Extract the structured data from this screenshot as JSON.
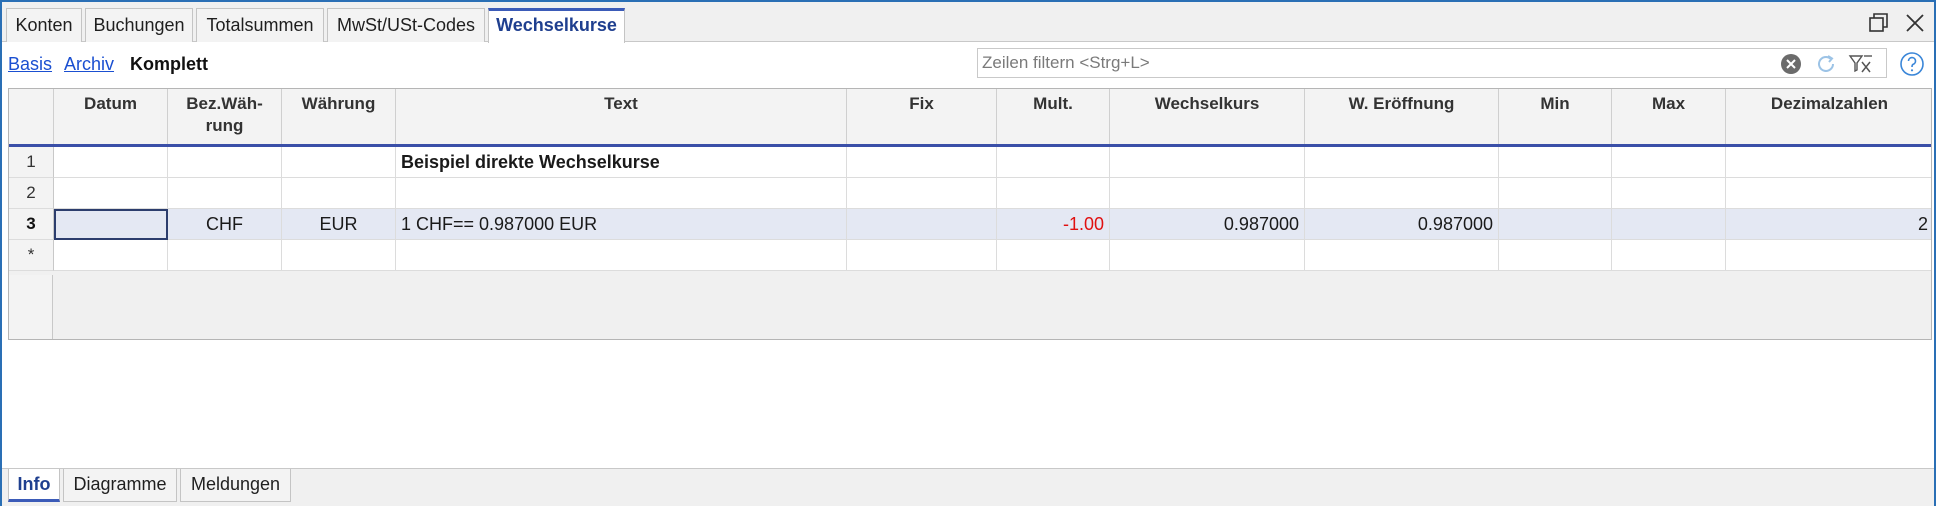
{
  "tabs": [
    {
      "label": "Konten"
    },
    {
      "label": "Buchungen"
    },
    {
      "label": "Totalsummen"
    },
    {
      "label": "MwSt/USt-Codes"
    },
    {
      "label": "Wechselkurse",
      "active": true
    }
  ],
  "views": [
    {
      "label": "Basis"
    },
    {
      "label": "Archiv"
    },
    {
      "label": "Komplett",
      "active": true
    }
  ],
  "filter": {
    "placeholder": "Zeilen filtern <Strg+L>",
    "value": ""
  },
  "icons": {
    "restore": "restore-window-icon",
    "close": "close-icon",
    "clear": "clear-filter-icon",
    "refresh": "refresh-icon",
    "filter_options": "filter-options-icon",
    "help": "help-icon"
  },
  "columns": {
    "datum": "Datum",
    "bez_waehrung_1": "Bez.Wäh-",
    "bez_waehrung_2": "rung",
    "waehrung": "Währung",
    "text": "Text",
    "fix": "Fix",
    "mult": "Mult.",
    "wechselkurs": "Wechselkurs",
    "w_eroeffnung": "W. Eröffnung",
    "min": "Min",
    "max": "Max",
    "dezimalzahlen": "Dezimalzahlen"
  },
  "rows": [
    {
      "num": "1",
      "datum": "",
      "bez": "",
      "waehrung": "",
      "text": "Beispiel direkte Wechselkurse",
      "fix": "",
      "mult": "",
      "kurs": "",
      "eroeffnung": "",
      "min": "",
      "max": "",
      "dez": ""
    },
    {
      "num": "2",
      "datum": "",
      "bez": "",
      "waehrung": "",
      "text": "",
      "fix": "",
      "mult": "",
      "kurs": "",
      "eroeffnung": "",
      "min": "",
      "max": "",
      "dez": ""
    },
    {
      "num": "3",
      "datum": "",
      "bez": "CHF",
      "waehrung": "EUR",
      "text": "1 CHF== 0.987000 EUR",
      "fix": "",
      "mult": "-1.00",
      "kurs": "0.987000",
      "eroeffnung": "0.987000",
      "min": "",
      "max": "",
      "dez": "2"
    },
    {
      "num": "*",
      "datum": "",
      "bez": "",
      "waehrung": "",
      "text": "",
      "fix": "",
      "mult": "",
      "kurs": "",
      "eroeffnung": "",
      "min": "",
      "max": "",
      "dez": ""
    }
  ],
  "bottom_tabs": [
    {
      "label": "Info",
      "active": true
    },
    {
      "label": "Diagramme"
    },
    {
      "label": "Meldungen"
    }
  ],
  "colors": {
    "accent": "#3b5bb8",
    "negative": "#e01010",
    "selected_row": "#e4e8f3",
    "frame": "#2a6fb5"
  }
}
